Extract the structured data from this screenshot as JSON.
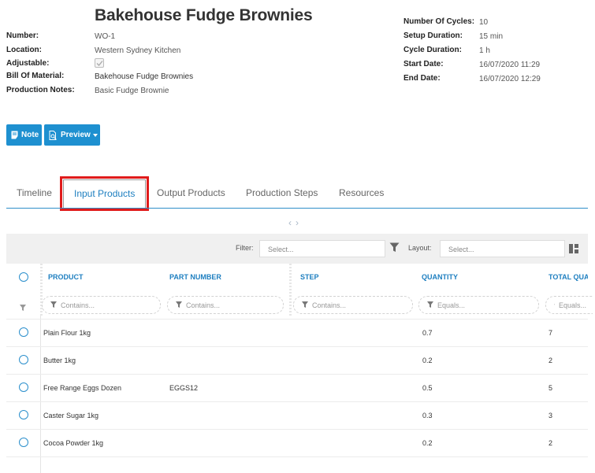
{
  "header": {
    "title": "Bakehouse Fudge Brownies"
  },
  "details_left": {
    "number_label": "Number:",
    "number_value": "WO-1",
    "location_label": "Location:",
    "location_value": "Western Sydney Kitchen",
    "adjustable_label": "Adjustable:",
    "adjustable_checked": true,
    "bom_label": "Bill Of Material:",
    "bom_value": "Bakehouse Fudge Brownies",
    "notes_label": "Production Notes:",
    "notes_value": "Basic Fudge Brownie"
  },
  "details_right": {
    "cycles_label": "Number Of Cycles:",
    "cycles_value": "10",
    "setup_label": "Setup Duration:",
    "setup_value": "15 min",
    "cycle_label": "Cycle Duration:",
    "cycle_value": "1 h",
    "start_label": "Start Date:",
    "start_value": "16/07/2020 11:29",
    "end_label": "End Date:",
    "end_value": "16/07/2020 12:29"
  },
  "actions": {
    "note_label": "Note",
    "preview_label": "Preview"
  },
  "tabs": [
    {
      "label": "Timeline",
      "active": false
    },
    {
      "label": "Input Products",
      "active": true
    },
    {
      "label": "Output Products",
      "active": false
    },
    {
      "label": "Production Steps",
      "active": false
    },
    {
      "label": "Resources",
      "active": false
    }
  ],
  "toolbar": {
    "filter_label": "Filter:",
    "filter_placeholder": "Select...",
    "layout_label": "Layout:",
    "layout_placeholder": "Select..."
  },
  "table": {
    "columns": [
      "PRODUCT",
      "PART NUMBER",
      "STEP",
      "QUANTITY",
      "TOTAL QUAN"
    ],
    "filters": [
      "Contains...",
      "Contains...",
      "Contains...",
      "Equals...",
      "Equals..."
    ],
    "rows": [
      {
        "product": "Plain Flour 1kg",
        "part_number": "",
        "step": "",
        "quantity": "0.7",
        "total": "7"
      },
      {
        "product": "Butter 1kg",
        "part_number": "",
        "step": "",
        "quantity": "0.2",
        "total": "2"
      },
      {
        "product": "Free Range Eggs Dozen",
        "part_number": "EGGS12",
        "step": "",
        "quantity": "0.5",
        "total": "5"
      },
      {
        "product": "Caster Sugar 1kg",
        "part_number": "",
        "step": "",
        "quantity": "0.3",
        "total": "3"
      },
      {
        "product": "Cocoa Powder 1kg",
        "part_number": "",
        "step": "",
        "quantity": "0.2",
        "total": "2"
      }
    ]
  },
  "colors": {
    "accent": "#1e90d0",
    "highlight": "#e01b1b"
  }
}
